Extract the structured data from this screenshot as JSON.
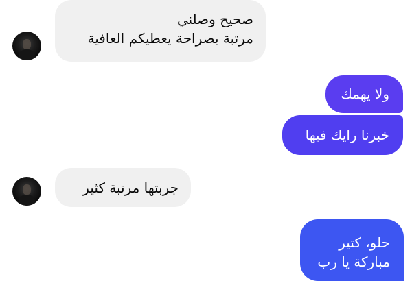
{
  "conversation": {
    "messages": [
      {
        "sender": "other",
        "lines": [
          "صحيح وصلني",
          "مرتبة بصراحة يعطيكم العافية"
        ]
      },
      {
        "sender": "me",
        "lines": [
          "ولا يهمك"
        ],
        "color": "#5a3df0"
      },
      {
        "sender": "me",
        "lines": [
          "خبرنا رايك فيها"
        ],
        "color": "#503ef0"
      },
      {
        "sender": "other",
        "lines": [
          "جربتها مرتبة كثير"
        ]
      },
      {
        "sender": "me",
        "lines": [
          "حلو، كتير",
          "مباركة يا رب"
        ],
        "color": "#3d56f2"
      }
    ]
  },
  "colors": {
    "incoming_bubble": "#f0f0f0",
    "incoming_text": "#0a0a0a",
    "outgoing_text": "#ffffff",
    "background": "#ffffff"
  },
  "icons": {
    "contact_avatar": "avatar"
  }
}
